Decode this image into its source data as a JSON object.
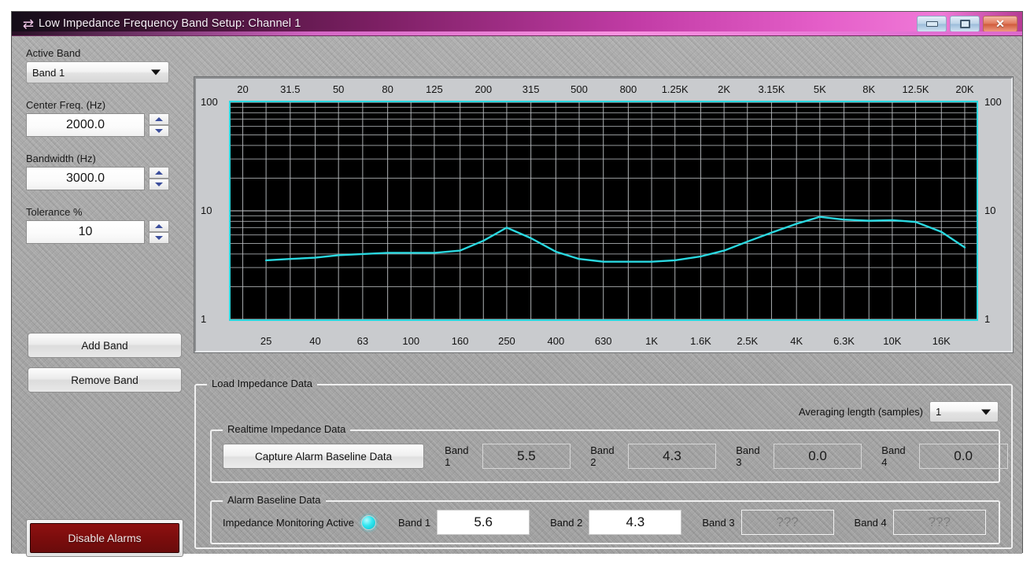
{
  "window": {
    "title": "Low Impedance Frequency Band Setup: Channel 1",
    "icon": "transfer-arrows-icon",
    "buttons": {
      "minimize": "minimize-icon",
      "maximize": "maximize-icon",
      "close": "close-icon"
    }
  },
  "left_panel": {
    "active_band_label": "Active Band",
    "active_band_value": "Band 1",
    "center_freq_label": "Center Freq. (Hz)",
    "center_freq_value": "2000.0",
    "bandwidth_label": "Bandwidth (Hz)",
    "bandwidth_value": "3000.0",
    "tolerance_label": "Tolerance %",
    "tolerance_value": "10",
    "add_band_label": "Add Band",
    "remove_band_label": "Remove Band",
    "disable_alarms_label": "Disable Alarms"
  },
  "load_impedance": {
    "title": "Load Impedance Data",
    "averaging_label": "Averaging length (samples)",
    "averaging_value": "1",
    "realtime": {
      "title": "Realtime Impedance Data",
      "capture_label": "Capture Alarm Baseline Data",
      "bands": [
        {
          "label": "Band 1",
          "value": "5.5"
        },
        {
          "label": "Band 2",
          "value": "4.3"
        },
        {
          "label": "Band 3",
          "value": "0.0"
        },
        {
          "label": "Band 4",
          "value": "0.0"
        }
      ]
    },
    "baseline": {
      "title": "Alarm Baseline Data",
      "monitoring_label": "Impedance Monitoring Active",
      "bands": [
        {
          "label": "Band 1",
          "value": "5.6"
        },
        {
          "label": "Band 2",
          "value": "4.3"
        },
        {
          "label": "Band 3",
          "value": "???"
        },
        {
          "label": "Band 4",
          "value": "???"
        }
      ]
    }
  },
  "chart_data": {
    "type": "line",
    "title": "",
    "xlabel": "",
    "ylabel": "",
    "xscale": "log",
    "yscale": "log",
    "xlim": [
      17.8,
      22400
    ],
    "ylim": [
      1,
      100
    ],
    "grid": true,
    "legend": "none",
    "line_color": "#2ad8e0",
    "background": "#000000",
    "gridline_color": "#b9bdc0",
    "top_ticks": [
      "20",
      "31.5",
      "50",
      "80",
      "125",
      "200",
      "315",
      "500",
      "800",
      "1.25K",
      "2K",
      "3.15K",
      "5K",
      "8K",
      "12.5K",
      "20K"
    ],
    "bottom_ticks": [
      "25",
      "40",
      "63",
      "100",
      "160",
      "250",
      "400",
      "630",
      "1K",
      "1.6K",
      "2.5K",
      "4K",
      "6.3K",
      "10K",
      "16K"
    ],
    "y_ticks_left": [
      "100",
      "10",
      "1"
    ],
    "y_ticks_right": [
      "100",
      "10",
      "1"
    ],
    "x": [
      25,
      31.5,
      40,
      50,
      63,
      80,
      100,
      125,
      160,
      200,
      250,
      315,
      400,
      500,
      630,
      800,
      1000,
      1250,
      1600,
      2000,
      2500,
      3150,
      4000,
      5000,
      6300,
      8000,
      10000,
      12500,
      16000
    ],
    "values": [
      3.5,
      3.6,
      3.7,
      3.9,
      4.0,
      4.1,
      4.1,
      4.1,
      4.3,
      5.3,
      7.0,
      5.6,
      4.2,
      3.6,
      3.4,
      3.4,
      3.4,
      3.5,
      3.8,
      4.3,
      5.2,
      6.3,
      7.6,
      8.8,
      8.3,
      8.1,
      8.2,
      7.9,
      6.4
    ],
    "x_end": 20000,
    "value_end": 4.6
  }
}
